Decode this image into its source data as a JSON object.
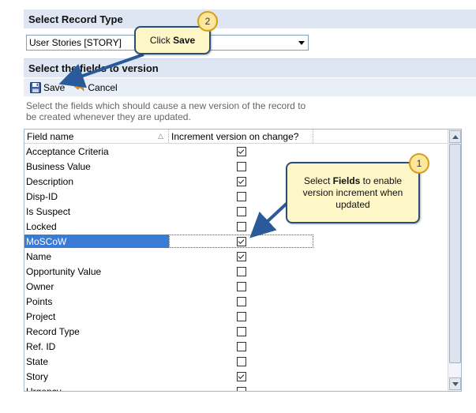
{
  "record_type": {
    "header": "Select Record Type",
    "selected": "User Stories [STORY]"
  },
  "fields_section": {
    "header": "Select the fields to version",
    "save_label": "Save",
    "cancel_label": "Cancel",
    "description": "Select the fields which should cause a new version of the record to be created whenever they are updated."
  },
  "grid": {
    "col_name": "Field name",
    "col_increment": "Increment version on change?",
    "rows": [
      {
        "name": "Acceptance Criteria",
        "checked": true
      },
      {
        "name": "Business Value",
        "checked": false
      },
      {
        "name": "Description",
        "checked": true
      },
      {
        "name": "Disp-ID",
        "checked": false
      },
      {
        "name": "Is Suspect",
        "checked": false
      },
      {
        "name": "Locked",
        "checked": false
      },
      {
        "name": "MoSCoW",
        "checked": true,
        "selected": true
      },
      {
        "name": "Name",
        "checked": true
      },
      {
        "name": "Opportunity Value",
        "checked": false
      },
      {
        "name": "Owner",
        "checked": false
      },
      {
        "name": "Points",
        "checked": false
      },
      {
        "name": "Project",
        "checked": false
      },
      {
        "name": "Record Type",
        "checked": false
      },
      {
        "name": "Ref. ID",
        "checked": false
      },
      {
        "name": "State",
        "checked": false
      },
      {
        "name": "Story",
        "checked": true
      },
      {
        "name": "Urgency",
        "checked": false
      }
    ]
  },
  "callouts": {
    "c1_number": "1",
    "c1_pre": "Select ",
    "c1_bold": "Fields",
    "c1_post": " to enable version increment when updated",
    "c2_number": "2",
    "c2_pre": "Click ",
    "c2_bold": "Save"
  },
  "colors": {
    "selection": "#3a7bd5",
    "header_bg": "#dde6f2",
    "callout_bg": "#fdf7c8",
    "callout_border": "#2a4e7a"
  }
}
